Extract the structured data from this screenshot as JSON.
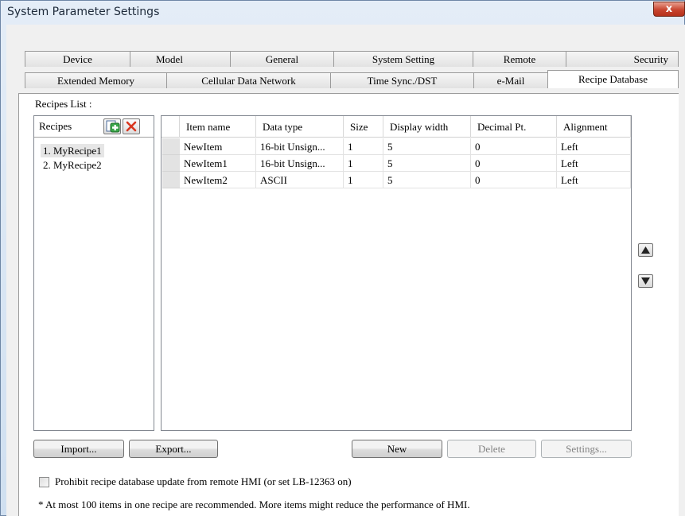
{
  "window": {
    "title": "System Parameter Settings",
    "close_label": "x"
  },
  "tabs": {
    "row1": [
      "Device",
      "Model",
      "General",
      "System Setting",
      "Remote",
      "Security"
    ],
    "row2": [
      "Extended Memory",
      "Cellular Data Network",
      "Time Sync./DST",
      "e-Mail",
      "Recipe Database"
    ],
    "active": "Recipe Database"
  },
  "recipes_list": {
    "label": "Recipes List :",
    "header": "Recipes",
    "items": [
      "1. MyRecipe1",
      "2. MyRecipe2"
    ],
    "selected_index": 0
  },
  "items_table": {
    "columns": [
      "Item name",
      "Data type",
      "Size",
      "Display width",
      "Decimal Pt.",
      "Alignment"
    ],
    "rows": [
      [
        "NewItem",
        "16-bit Unsign...",
        "1",
        "5",
        "0",
        "Left"
      ],
      [
        "NewItem1",
        "16-bit Unsign...",
        "1",
        "5",
        "0",
        "Left"
      ],
      [
        "NewItem2",
        "ASCII",
        "1",
        "5",
        "0",
        "Left"
      ]
    ]
  },
  "buttons": {
    "import": "Import...",
    "export": "Export...",
    "new": "New",
    "delete": "Delete",
    "settings": "Settings..."
  },
  "options": {
    "prohibit_update_label": "Prohibit recipe database update from remote HMI (or set LB-12363 on)",
    "prohibit_update_checked": false
  },
  "note": "* At most 100 items in one recipe are recommended. More items might reduce the performance of HMI.",
  "colors": {
    "accent_green": "#3aa64a",
    "delete_red": "#d9361f",
    "title_bar": "#d6e4f3"
  }
}
